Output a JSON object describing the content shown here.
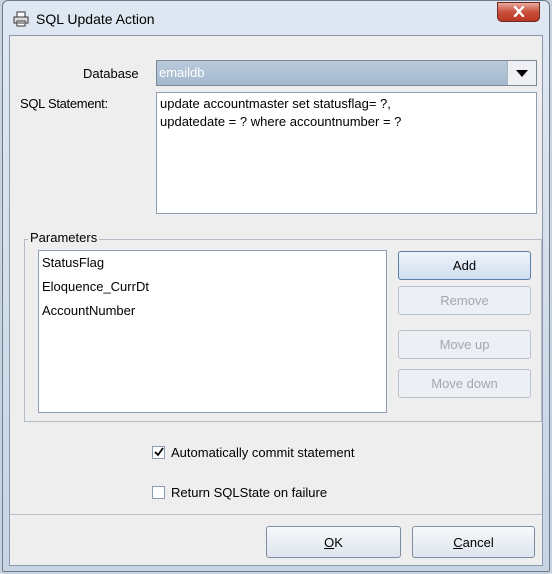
{
  "window": {
    "title": "SQL Update Action",
    "close_symbol": "X"
  },
  "form": {
    "database_label": "Database",
    "database_value": "emaildb",
    "sql_label": "SQL Statement:",
    "sql_value": "update accountmaster set statusflag= ?,\nupdatedate = ? where accountnumber = ?"
  },
  "parameters": {
    "legend": "Parameters",
    "items": [
      "StatusFlag",
      "Eloquence_CurrDt",
      "AccountNumber"
    ],
    "buttons": {
      "add": "Add",
      "remove": "Remove",
      "move_up": "Move up",
      "move_down": "Move down"
    }
  },
  "options": {
    "auto_commit": {
      "label": "Automatically commit statement",
      "checked": true
    },
    "return_sqlstate": {
      "label": "Return SQLState on failure",
      "checked": false
    }
  },
  "footer": {
    "ok_mnemonic": "O",
    "ok_rest": "K",
    "cancel_mnemonic": "C",
    "cancel_rest": "ancel"
  },
  "colors": {
    "accent": "#a7bcd3",
    "close": "#c44a35",
    "disabled_text": "#a2a8b0"
  },
  "icons": {
    "title": "printer-icon",
    "close": "close-icon",
    "dropdown": "chevron-down-icon",
    "check": "checkmark-icon"
  }
}
